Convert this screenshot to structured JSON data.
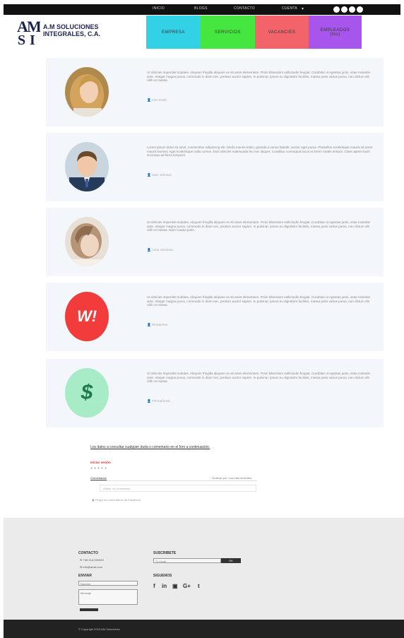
{
  "topnav": {
    "items": [
      "INICIO",
      "BLOGS",
      "CONTACTO",
      "CUENTA"
    ],
    "account_chevron": "▾"
  },
  "brand": {
    "line1": "A.M SOLUCIONES",
    "line2": "INTEGRALES, C.A."
  },
  "tiles": [
    {
      "label": "EMPRESA",
      "color": "#33d1e6"
    },
    {
      "label": "SERVICIOS",
      "color": "#46e640"
    },
    {
      "label": "VACANCIES",
      "color": "#f2646a"
    },
    {
      "label": "EMPLEADOS",
      "sub": "(Inc)",
      "color": "#a855ee"
    }
  ],
  "cards": [
    {
      "text": "Ut ultricies imperdiet sodales. Aliquam fringilla aliquam ex sit amet elementum. Proin bibendum sollicitudin feugiat. Curabitur ut egestas justo, vitae molestie ante. Integer magna purus, commodo in diam nec, pretium auctor sapien. In pulvinar, ipsum eu dignissim facilisis, massa justo varius purus, non dictum elit nibh ut massa.",
      "author": "Ann Smith",
      "avatar": "woman-photo"
    },
    {
      "text": "Lorem ipsum dolor sit amet, consectetur adipiscing elit. Morbi mauris tellus, gravida a varius blandit, auctor eget purus. Phasellus scelerisque mauris sit amet mauris laoreet, eget scelerisque nulla cursus. Duis ultricies malesuada leo nec aliquet. Curabitur consequat lacus et lorem mattis tempor. Class aptent taciti sociosqu ad litora torquent.",
      "author": "Sam Johnson",
      "avatar": "man-photo"
    },
    {
      "text": "Ut ultricies imperdiet sodales. Aliquam fringilla aliquam ex sit amet elementum. Proin bibendum sollicitudin feugiat. Curabitur ut egestas justo, vitae molestie ante. Integer magna purus, commodo in diam nec, pretium auctor sapien. In pulvinar, ipsum eu dignissim facilisis, massa justo varius purus, non dictum elit nibh ut massa. Nam massa justo.",
      "author": "Anna Vandana",
      "avatar": "girl-photo"
    },
    {
      "text": "Ut ultricies imperdiet sodales. Aliquam fringilla aliquam ex sit amet elementum. Proin bibendum sollicitudin feugiat. Curabitur ut egestas justo, vitae molestie ante. Integer magna purus, commodo in diam nec, pretium auctor sapien. In pulvinar, ipsum eu dignissim facilisis, massa justo varius purus, non dictum elit nibh ut massa.",
      "author": "Wordpress",
      "avatar": "W!"
    },
    {
      "text": "Ut ultricies imperdiet sodales. Aliquam fringilla aliquam ex sit amet elementum. Proin bibendum sollicitudin feugiat. Curabitur ut egestas justo, vitae molestie ante. Integer magna purus, commodo in diam nec, pretium auctor sapien. In pulvinar, ipsum eu dignissim facilisis, massa justo varius purus, non dictum elit nibh ut massa.",
      "author": "Themeforest",
      "avatar": "$"
    }
  ],
  "comment": {
    "heading": "Los datos a consultar cualquier duda o comentario en el foro a continuación.",
    "login_link": "Iniciar sesión",
    "filter_left": "Comentarios",
    "filter_right": "Ordenar por: Los más recientes",
    "input_placeholder": "Añadir un comentario...",
    "plugin_text": "Plugin de comentarios de Facebook"
  },
  "footer": {
    "contact_h": "CONTACTO",
    "phone": "+58 414-000000",
    "email": "info@amsi.com",
    "subscribe_h": "SUSCRIBETE",
    "subscribe_placeholder": "Tu email",
    "subscribe_button": "OK",
    "form_h": "ENVIAR",
    "name_placeholder": "Nombre",
    "message_placeholder": "Mensaje",
    "send_button": "Enviar",
    "social_h": "SIGUENOS",
    "social": [
      "f",
      "in",
      "▣",
      "G+",
      "t"
    ],
    "copyright": "© Copyright 2015 AM Soluciones"
  }
}
